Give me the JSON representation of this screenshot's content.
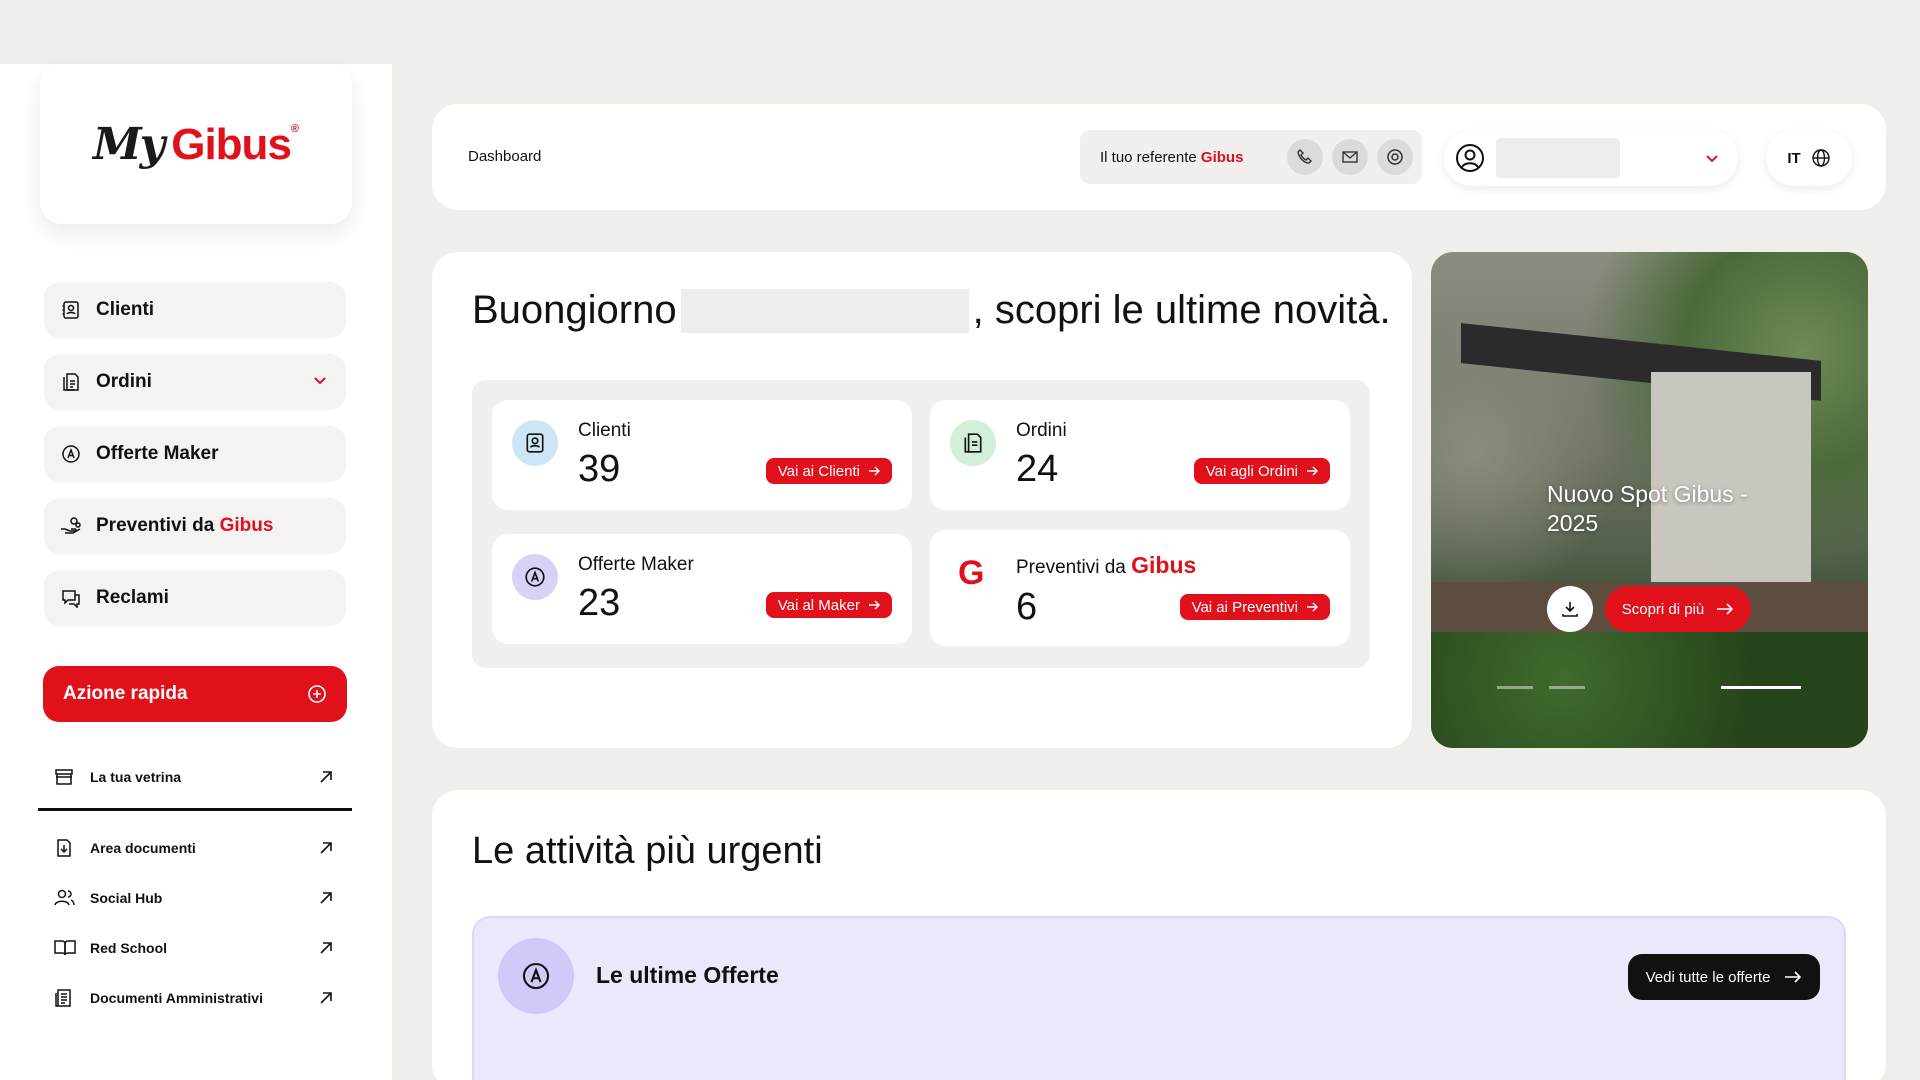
{
  "logo": {
    "my": "My",
    "brand": "Gibus",
    "reg": "®"
  },
  "sidebar": {
    "items": [
      {
        "label": "Clienti",
        "icon": "contacts-icon"
      },
      {
        "label": "Ordini",
        "icon": "orders-icon"
      },
      {
        "label": "Offerte Maker",
        "icon": "maker-icon"
      },
      {
        "label_prefix": "Preventivi da",
        "label_brand": "Gibus",
        "icon": "hand-coins-icon"
      },
      {
        "label": "Reclami",
        "icon": "chat-icon"
      }
    ],
    "quick_action": "Azione rapida",
    "links": [
      {
        "label": "La tua vetrina",
        "icon": "store-icon"
      },
      {
        "label": "Area documenti",
        "icon": "document-download-icon"
      },
      {
        "label": "Social Hub",
        "icon": "users-icon"
      },
      {
        "label": "Red School",
        "icon": "book-icon"
      },
      {
        "label": "Documenti Amministrativi",
        "icon": "admin-docs-icon"
      }
    ]
  },
  "header": {
    "breadcrumb": "Dashboard",
    "referent_prefix": "Il tuo referente",
    "referent_brand": "Gibus",
    "language": "IT"
  },
  "welcome": {
    "greeting": "Buongiorno",
    "suffix": ", scopri le ultime novità.",
    "stats": [
      {
        "title": "Clienti",
        "value": "39",
        "button": "Vai ai Clienti",
        "color": "#cde6f5"
      },
      {
        "title": "Ordini",
        "value": "24",
        "button": "Vai agli Ordini",
        "color": "#d3efd9"
      },
      {
        "title": "Offerte Maker",
        "value": "23",
        "button": "Vai al Maker",
        "color": "#d6d3f7"
      },
      {
        "title_prefix": "Preventivi da",
        "title_brand": "Gibus",
        "value": "6",
        "button": "Vai ai Preventivi",
        "mark": "G"
      }
    ]
  },
  "promo": {
    "title": "Nuovo Spot Gibus - 2025",
    "cta": "Scopri di più"
  },
  "urgent": {
    "heading": "Le attività più urgenti",
    "offers_title": "Le ultime Offerte",
    "offers_button": "Vedi tutte le offerte"
  },
  "colors": {
    "brand_red": "#e0111b",
    "background": "#f0eeeb",
    "offers_bg": "#eae8fb"
  }
}
